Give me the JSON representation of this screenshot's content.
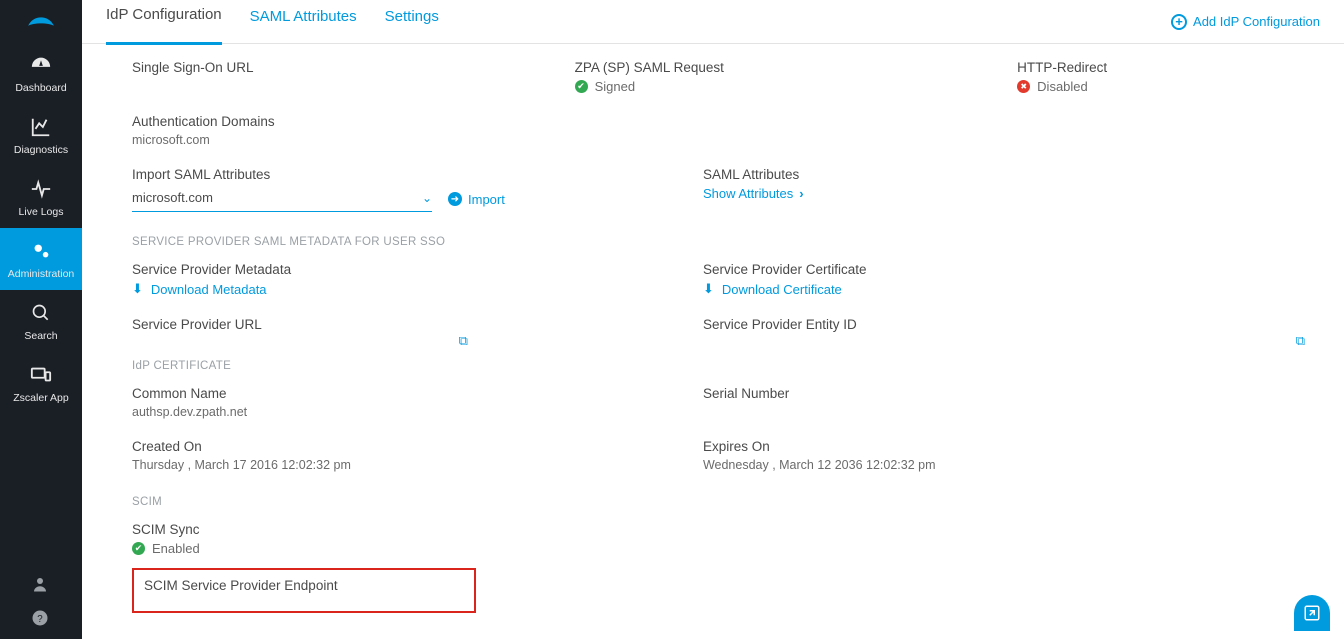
{
  "sidebar": {
    "items": [
      {
        "label": "Dashboard"
      },
      {
        "label": "Diagnostics"
      },
      {
        "label": "Live Logs"
      },
      {
        "label": "Administration"
      },
      {
        "label": "Search"
      },
      {
        "label": "Zscaler App"
      }
    ]
  },
  "tabs": {
    "items": [
      {
        "label": "IdP Configuration"
      },
      {
        "label": "SAML Attributes"
      },
      {
        "label": "Settings"
      }
    ],
    "add_label": "Add IdP Configuration"
  },
  "sso": {
    "url_label": "Single Sign-On URL",
    "saml_request_label": "ZPA (SP) SAML Request",
    "saml_request_status": "Signed",
    "http_redirect_label": "HTTP-Redirect",
    "http_redirect_status": "Disabled"
  },
  "auth_domains": {
    "label": "Authentication Domains",
    "value": "microsoft.com"
  },
  "import_saml": {
    "label": "Import SAML Attributes",
    "selected": "microsoft.com",
    "import_btn": "Import"
  },
  "saml_attributes": {
    "label": "SAML Attributes",
    "show_link": "Show Attributes"
  },
  "sp_meta_section": "SERVICE PROVIDER SAML METADATA FOR USER SSO",
  "sp_meta": {
    "label": "Service Provider Metadata",
    "download": "Download Metadata"
  },
  "sp_cert": {
    "label": "Service Provider Certificate",
    "download": "Download Certificate"
  },
  "sp_url": {
    "label": "Service Provider URL"
  },
  "sp_entity": {
    "label": "Service Provider Entity ID"
  },
  "idp_cert_section": "IdP CERTIFICATE",
  "cn": {
    "label": "Common Name",
    "value": "authsp.dev.zpath.net"
  },
  "serial": {
    "label": "Serial Number"
  },
  "created": {
    "label": "Created On",
    "value": "Thursday , March 17 2016 12:02:32 pm"
  },
  "expires": {
    "label": "Expires On",
    "value": "Wednesday , March 12 2036 12:02:32 pm"
  },
  "scim_section": "SCIM",
  "scim_sync": {
    "label": "SCIM Sync",
    "status": "Enabled"
  },
  "scim_endpoint": {
    "label": "SCIM Service Provider Endpoint"
  }
}
